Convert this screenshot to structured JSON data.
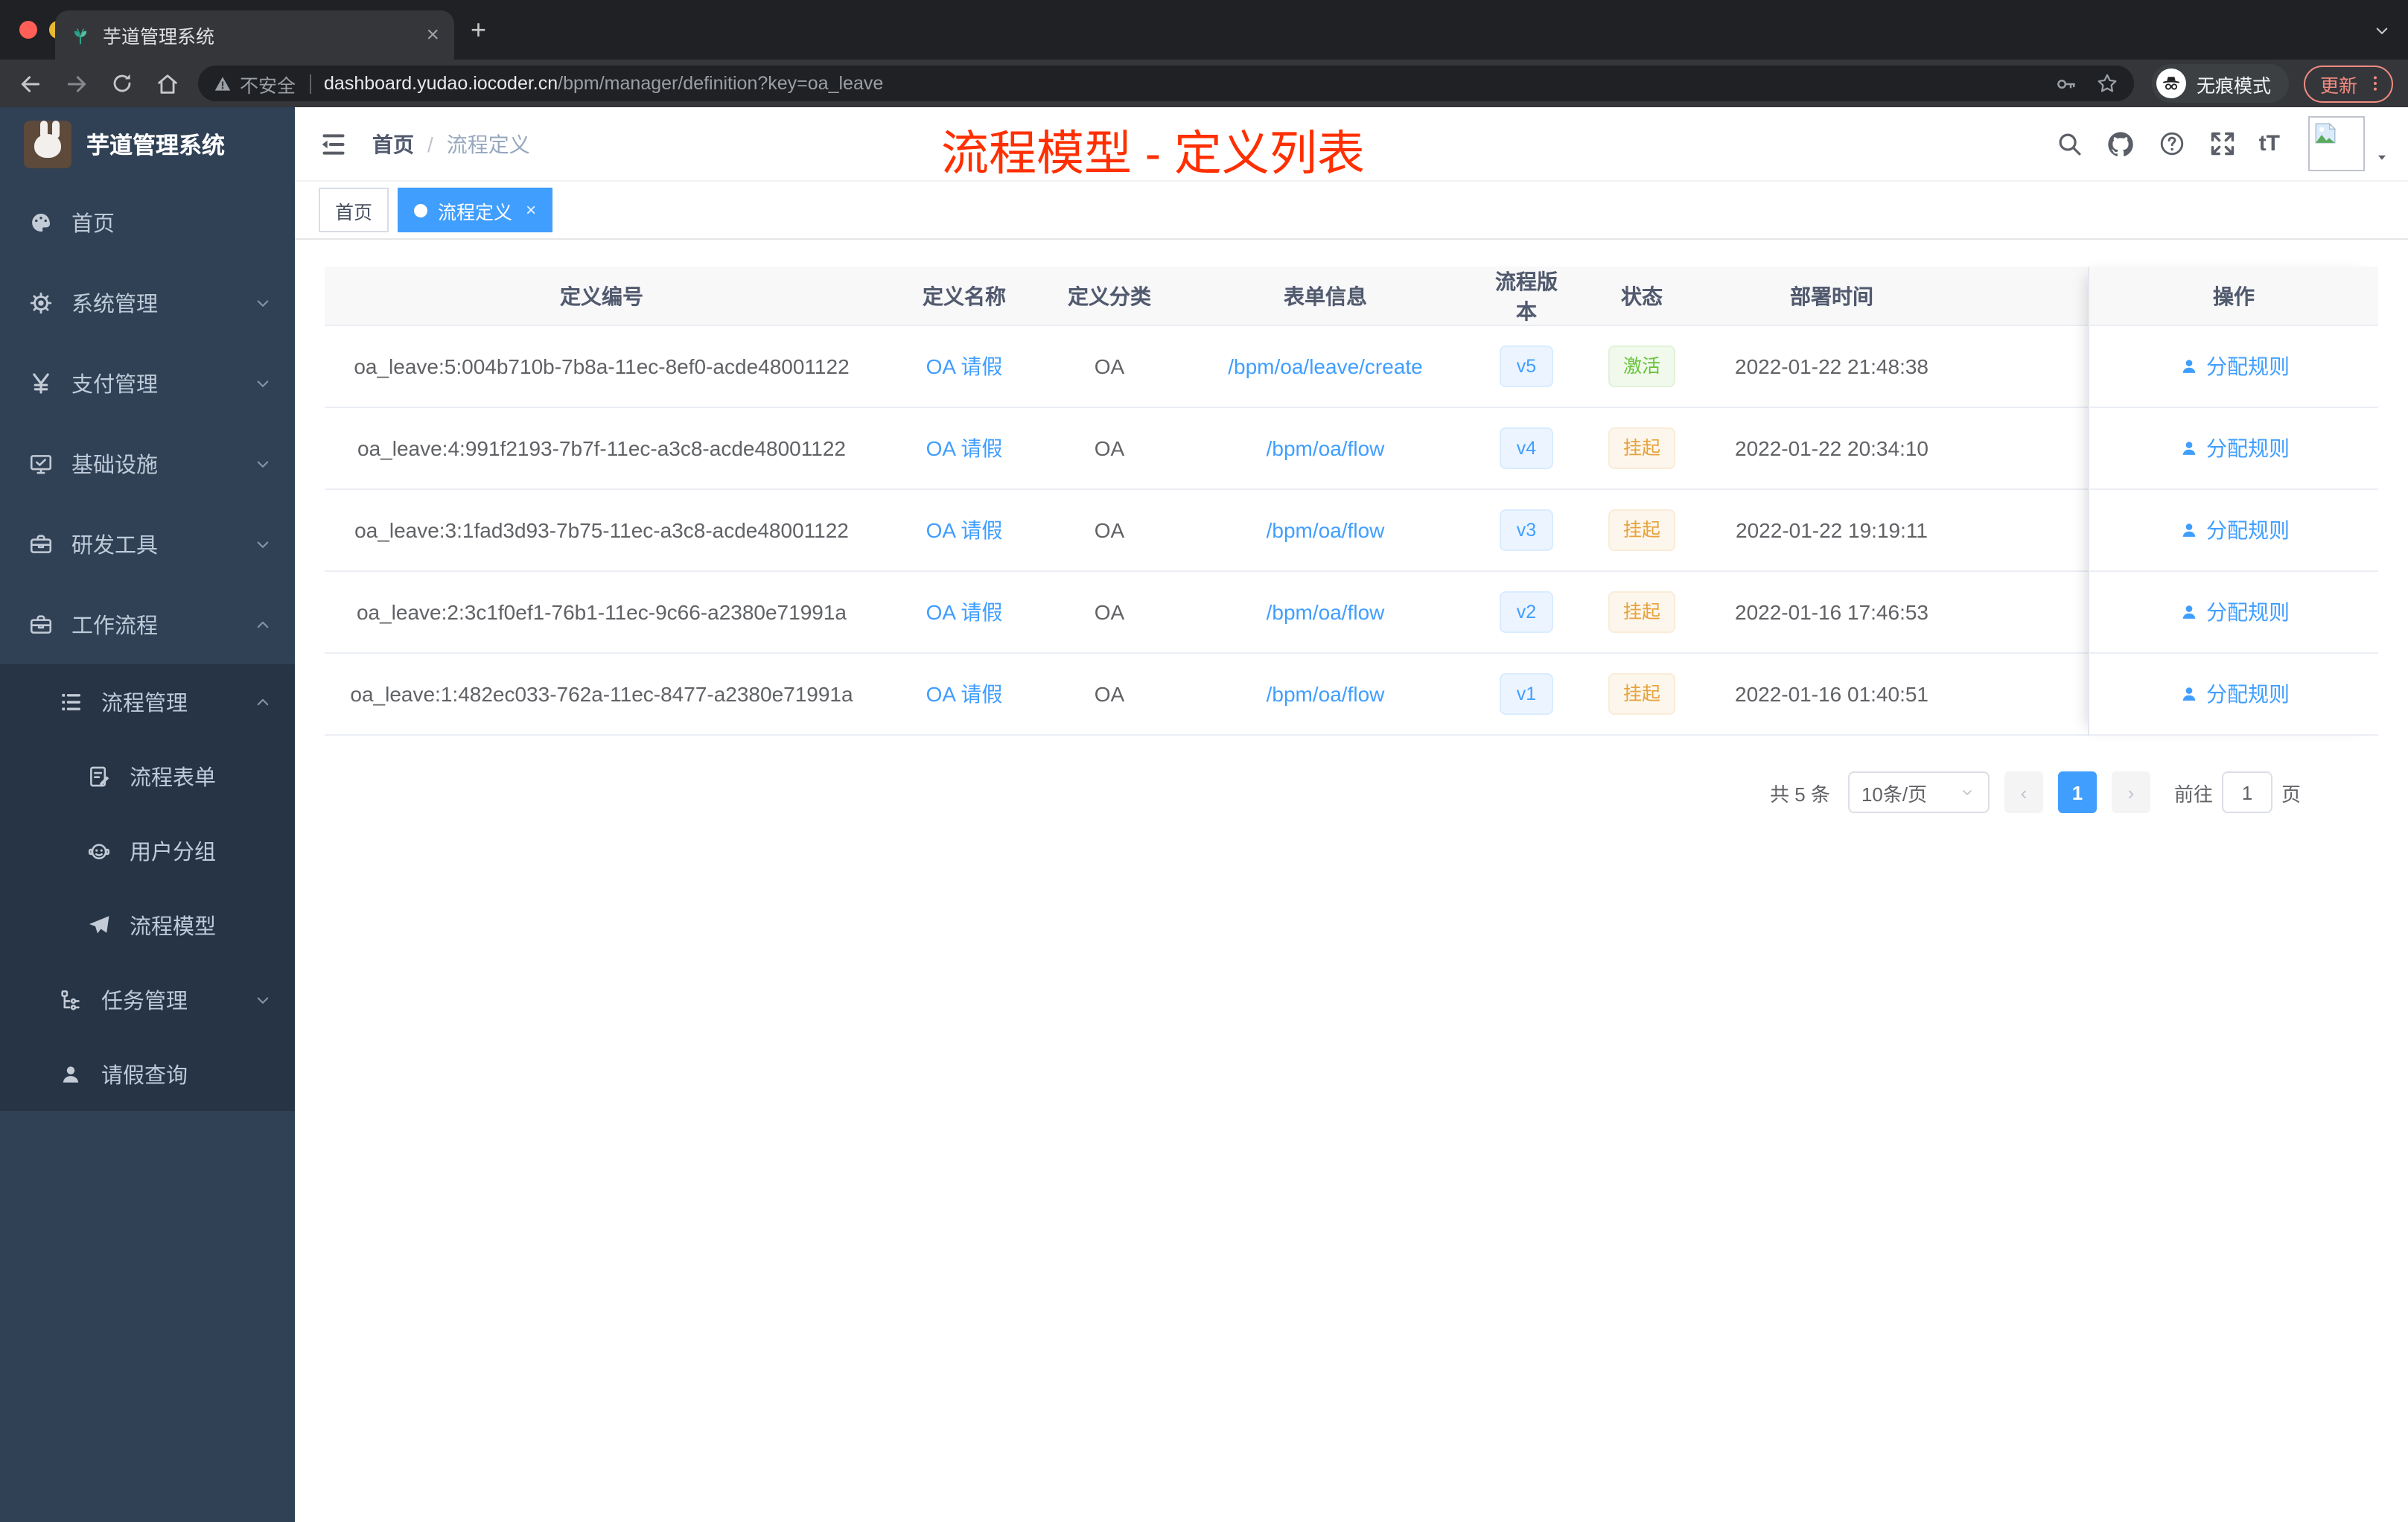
{
  "browser": {
    "tab_title": "芋道管理系统",
    "security_label": "不安全",
    "url_host": "dashboard.yudao.iocoder.cn",
    "url_path": "/bpm/manager/definition?key=oa_leave",
    "incognito_label": "无痕模式",
    "update_label": "更新"
  },
  "sidebar": {
    "app_title": "芋道管理系统",
    "items": [
      {
        "label": "首页"
      },
      {
        "label": "系统管理"
      },
      {
        "label": "支付管理"
      },
      {
        "label": "基础设施"
      },
      {
        "label": "研发工具"
      },
      {
        "label": "工作流程"
      },
      {
        "label": "流程管理"
      },
      {
        "label": "流程表单"
      },
      {
        "label": "用户分组"
      },
      {
        "label": "流程模型"
      },
      {
        "label": "任务管理"
      },
      {
        "label": "请假查询"
      }
    ]
  },
  "header": {
    "breadcrumb": [
      "首页",
      "流程定义"
    ],
    "annotation": "流程模型 - 定义列表",
    "font_size_label": "tT"
  },
  "tags": [
    "首页",
    "流程定义"
  ],
  "table": {
    "columns": [
      "定义编号",
      "定义名称",
      "定义分类",
      "表单信息",
      "流程版本",
      "状态",
      "部署时间",
      "操作"
    ],
    "rows": [
      {
        "id": "oa_leave:5:004b710b-7b8a-11ec-8ef0-acde48001122",
        "name": "OA 请假",
        "category": "OA",
        "form": "/bpm/oa/leave/create",
        "version": "v5",
        "status": "激活",
        "deploy_time": "2022-01-22 21:48:38",
        "action": "分配规则"
      },
      {
        "id": "oa_leave:4:991f2193-7b7f-11ec-a3c8-acde48001122",
        "name": "OA 请假",
        "category": "OA",
        "form": "/bpm/oa/flow",
        "version": "v4",
        "status": "挂起",
        "deploy_time": "2022-01-22 20:34:10",
        "action": "分配规则"
      },
      {
        "id": "oa_leave:3:1fad3d93-7b75-11ec-a3c8-acde48001122",
        "name": "OA 请假",
        "category": "OA",
        "form": "/bpm/oa/flow",
        "version": "v3",
        "status": "挂起",
        "deploy_time": "2022-01-22 19:19:11",
        "action": "分配规则"
      },
      {
        "id": "oa_leave:2:3c1f0ef1-76b1-11ec-9c66-a2380e71991a",
        "name": "OA 请假",
        "category": "OA",
        "form": "/bpm/oa/flow",
        "version": "v2",
        "status": "挂起",
        "deploy_time": "2022-01-16 17:46:53",
        "action": "分配规则"
      },
      {
        "id": "oa_leave:1:482ec033-762a-11ec-8477-a2380e71991a",
        "name": "OA 请假",
        "category": "OA",
        "form": "/bpm/oa/flow",
        "version": "v1",
        "status": "挂起",
        "deploy_time": "2022-01-16 01:40:51",
        "action": "分配规则"
      }
    ]
  },
  "pagination": {
    "total": "共 5 条",
    "page_size": "10条/页",
    "page": "1",
    "goto_label": "前往",
    "goto_value": "1",
    "page_unit": "页"
  },
  "colors": {
    "primary": "#409EFF",
    "success": "#67C23A",
    "warning": "#E6A23C",
    "annotation": "#FF2F00",
    "sidebar_bg": "#304156",
    "submenu_bg": "#263445"
  }
}
